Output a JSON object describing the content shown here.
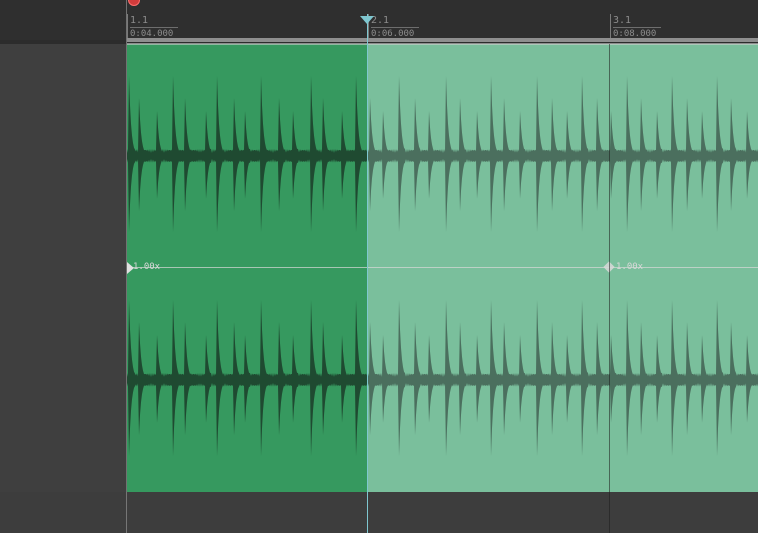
{
  "ruler": {
    "markers": [
      {
        "bar": "1.1",
        "time": "0:04.000"
      },
      {
        "bar": "2.1",
        "time": "0:06.000"
      },
      {
        "bar": "3.1",
        "time": "0:08.000"
      }
    ]
  },
  "clip": {
    "colors": {
      "selected": "#36995f",
      "unselected": "#7abf9c",
      "wave_selected": "#1f4a31",
      "wave_unselected": "#4b6f5e"
    }
  },
  "envelope": {
    "rate_labels": [
      "1.00x",
      "1.00x"
    ]
  },
  "icons": {
    "record": "record-icon",
    "cursor": "edit-cursor-icon",
    "envelope_point": "envelope-point-icon"
  }
}
